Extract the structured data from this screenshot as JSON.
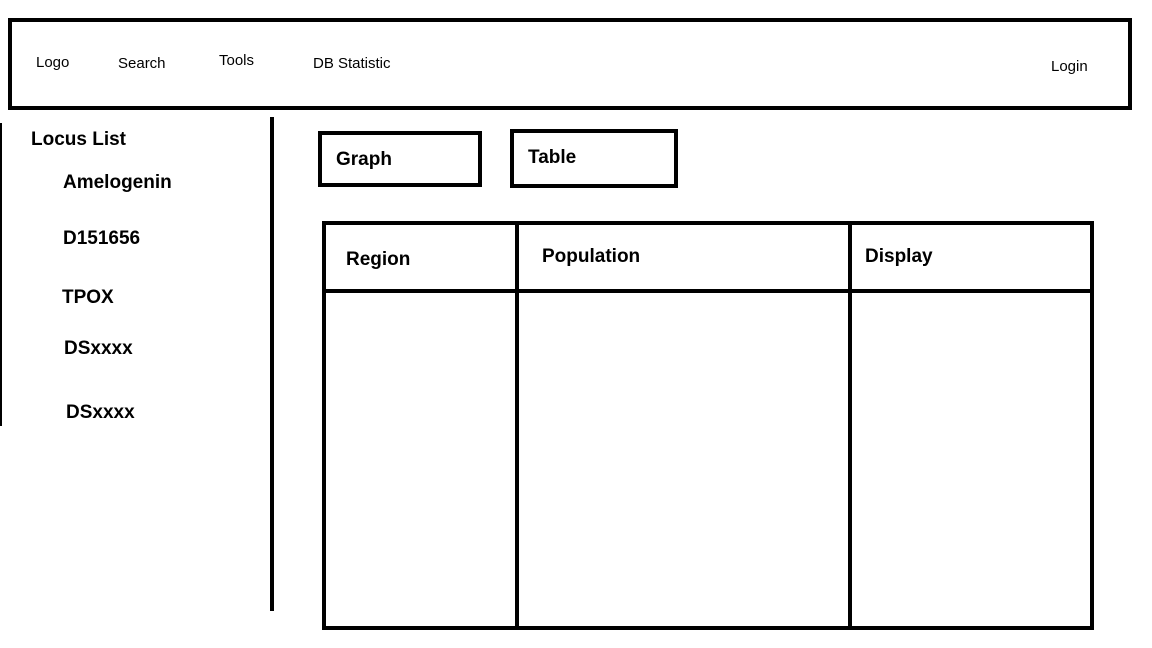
{
  "nav": {
    "logo": "Logo",
    "search": "Search",
    "tools": "Tools",
    "db_statistic": "DB Statistic",
    "login": "Login"
  },
  "sidebar": {
    "title": "Locus List",
    "items": [
      "Amelogenin",
      "D151656",
      "TPOX",
      "DSxxxx",
      "DSxxxx"
    ]
  },
  "tabs": {
    "graph": "Graph",
    "table": "Table"
  },
  "table": {
    "columns": [
      "Region",
      "Population",
      "Display"
    ]
  }
}
